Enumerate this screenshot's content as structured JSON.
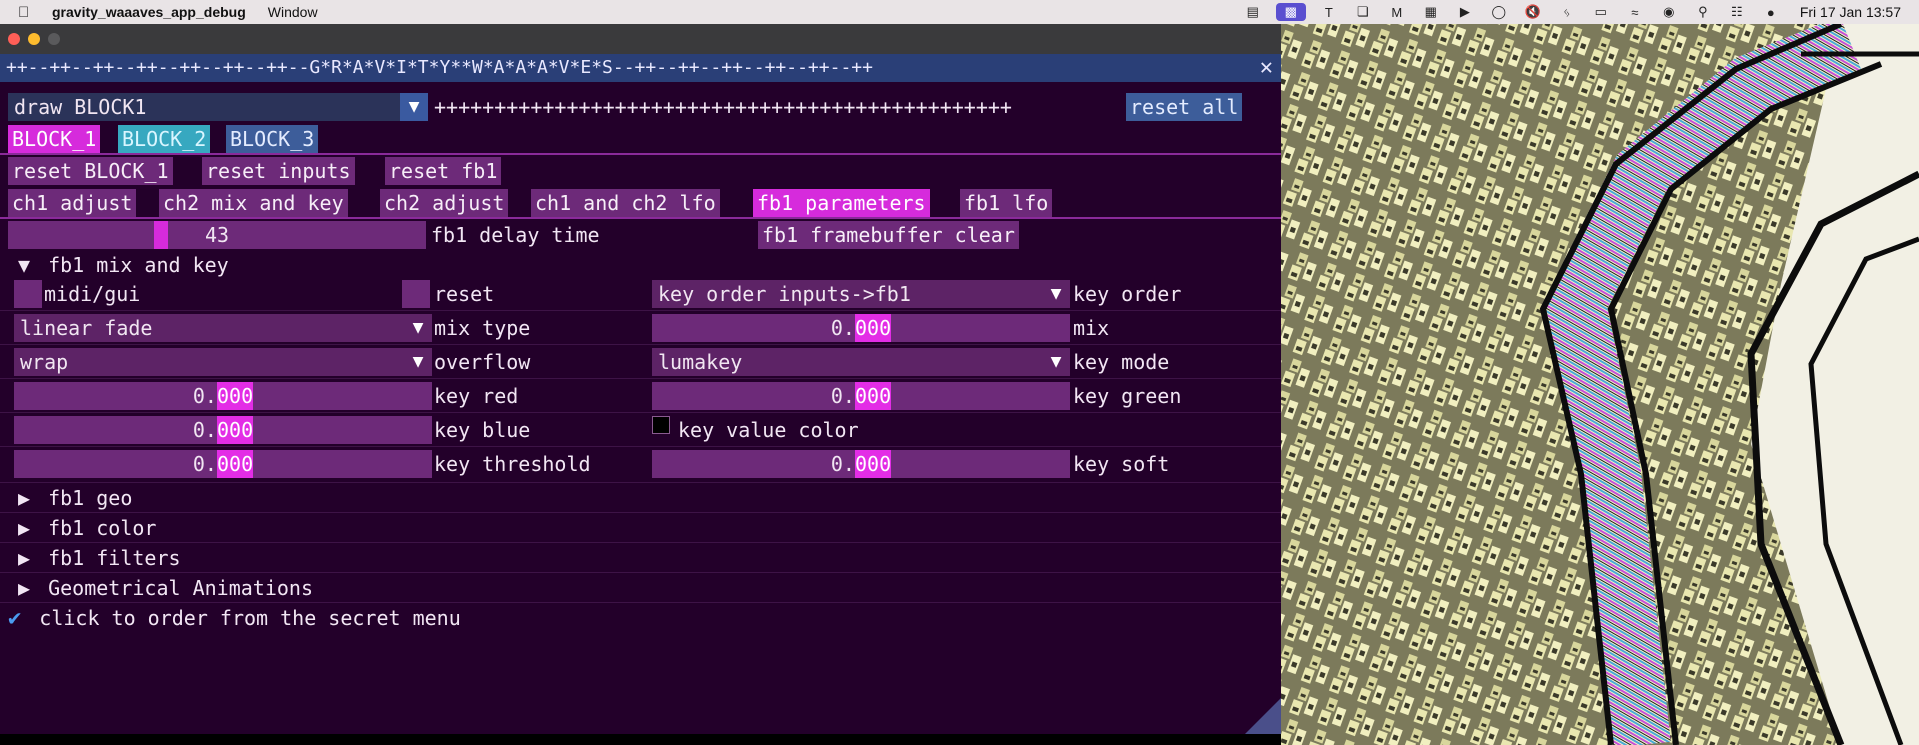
{
  "menubar": {
    "app_name": "gravity_waaaves_app_debug",
    "items": [
      "Window"
    ],
    "clock": "Fri 17 Jan  13:57",
    "tray_icons": [
      "cast-icon",
      "screen-mirror-icon",
      "text-icon",
      "layers-icon",
      "m-icon",
      "grid-icon",
      "play-icon",
      "timer-icon",
      "mute-icon",
      "bluetooth-icon",
      "battery-icon",
      "wifi-icon",
      "user-icon",
      "search-icon",
      "control-center-icon",
      "siri-icon"
    ]
  },
  "window": {
    "title": "++--++--++--++--++--++--++--G*R*A*V*I*T*Y**W*A*A*A*V*E*S--++--++--++--++--++--++"
  },
  "top_row": {
    "combo_value": "draw BLOCK1",
    "plus_string": "++++++++++++++++++++++++++++++++++++++++++++++++",
    "reset_all": "reset all"
  },
  "block_tabs": [
    "BLOCK_1",
    "BLOCK_2",
    "BLOCK_3"
  ],
  "reset_buttons": [
    "reset BLOCK_1",
    "reset inputs",
    "reset fb1"
  ],
  "section_tabs": [
    "ch1 adjust",
    "ch2 mix and key",
    "ch2 adjust",
    "ch1 and ch2 lfo",
    "fb1 parameters",
    "fb1 lfo"
  ],
  "delay": {
    "value": "43",
    "label": "fb1 delay time",
    "clear_button": "fb1 framebuffer clear"
  },
  "mix_and_key": {
    "header": "fb1 mix and key",
    "midi_label": "midi/gui",
    "reset_label": "reset",
    "key_order_value": "key order inputs->fb1",
    "key_order_label": "key order",
    "mix_type_value": "linear fade",
    "mix_type_label": "mix type",
    "mix_value_int": "0.",
    "mix_value_dec": "000",
    "mix_label": "mix",
    "overflow_value": "wrap",
    "overflow_label": "overflow",
    "key_mode_value": "lumakey",
    "key_mode_label": "key mode",
    "key_red_int": "0.",
    "key_red_dec": "000",
    "key_red_label": "key red",
    "key_green_int": "0.",
    "key_green_dec": "000",
    "key_green_label": "key green",
    "key_blue_int": "0.",
    "key_blue_dec": "000",
    "key_blue_label": "key blue",
    "key_value_color_label": "key value color",
    "key_threshold_int": "0.",
    "key_threshold_dec": "000",
    "key_threshold_label": "key threshold",
    "key_soft_int": "0.",
    "key_soft_dec": "000",
    "key_soft_label": "key soft"
  },
  "collapsed_sections": [
    "fb1 geo",
    "fb1 color",
    "fb1 filters",
    "Geometrical Animations"
  ],
  "secret_menu": "click to order from the secret menu",
  "colors": {
    "panel_bg": "#23002a",
    "widget": "#6d2a79",
    "accent": "#d62bdc",
    "title_bar": "#2a3f77"
  }
}
